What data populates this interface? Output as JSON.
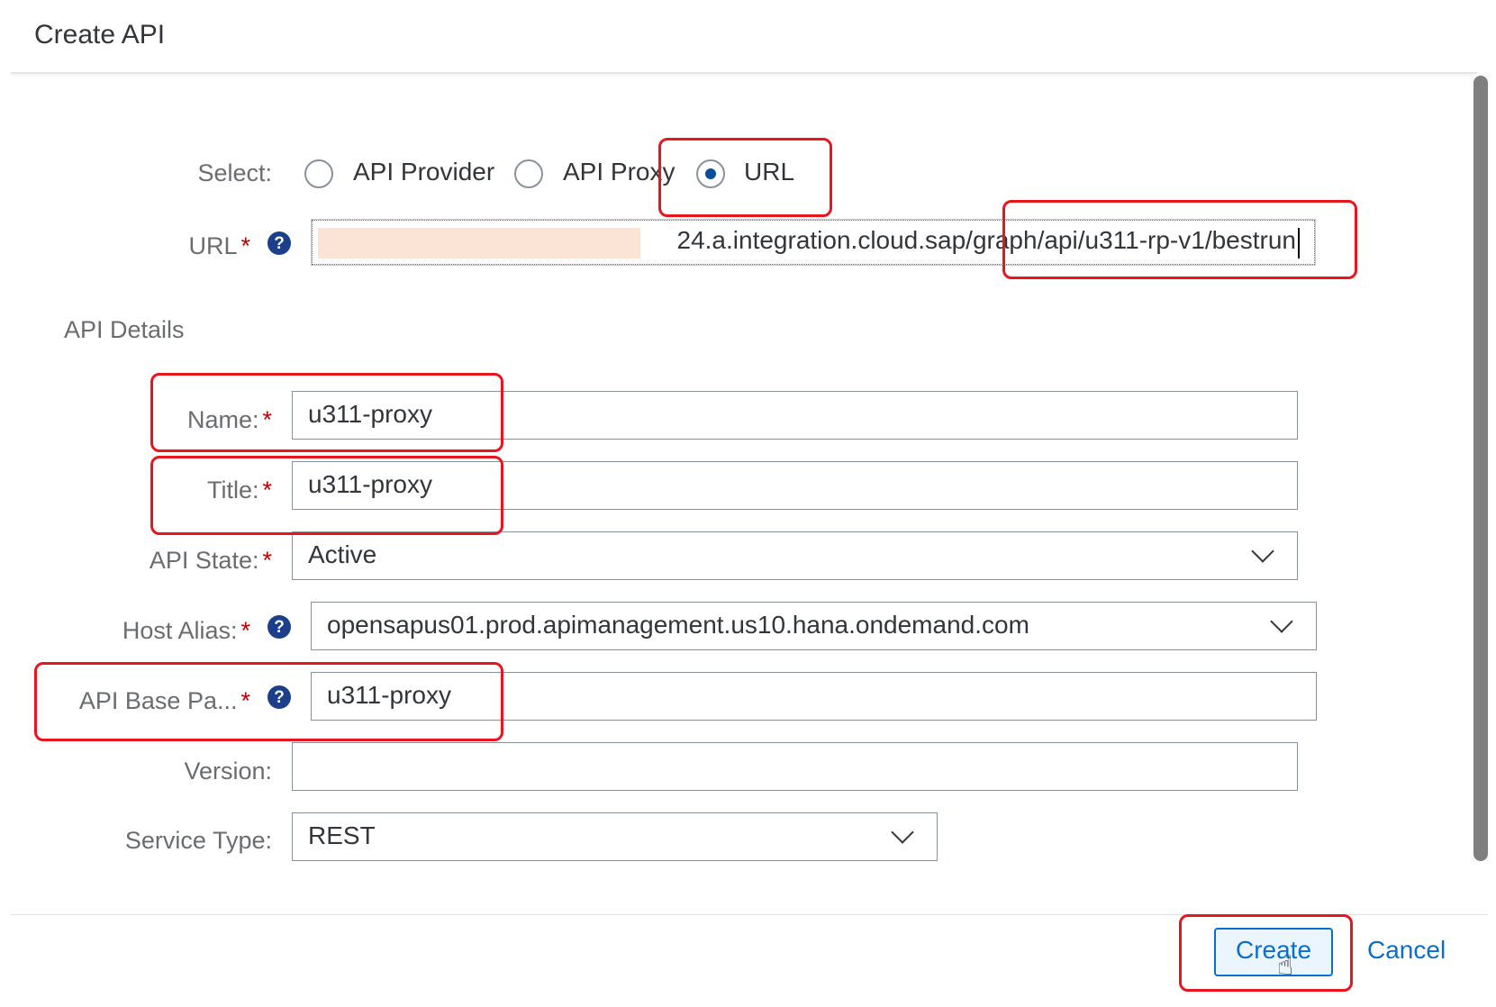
{
  "dialog": {
    "title": "Create API"
  },
  "select": {
    "label": "Select:",
    "options": [
      "API Provider",
      "API Proxy",
      "URL"
    ],
    "selected": "URL"
  },
  "url": {
    "label": "URL",
    "required_marker": "*",
    "value": "24.a.integration.cloud.sap/graph/api/u311-rp-v1/bestrun"
  },
  "details": {
    "section_title": "API Details",
    "name": {
      "label": "Name:",
      "value": "u311-proxy"
    },
    "title": {
      "label": "Title:",
      "value": "u311-proxy"
    },
    "state": {
      "label": "API State:",
      "value": "Active"
    },
    "host_alias": {
      "label": "Host Alias:",
      "value": "opensapus01.prod.apimanagement.us10.hana.ondemand.com"
    },
    "base_path": {
      "label": "API Base Pa...",
      "value": "u311-proxy"
    },
    "version": {
      "label": "Version:",
      "value": ""
    },
    "service_type": {
      "label": "Service Type:",
      "value": "REST"
    },
    "required_marker": "*"
  },
  "footer": {
    "create_label": "Create",
    "cancel_label": "Cancel"
  },
  "icons": {
    "help": "?",
    "cursor": "hand-pointer-icon"
  },
  "colors": {
    "accent": "#0a6ed1",
    "required": "#bb0000",
    "annotation": "#e8141e",
    "help_icon": "#1b3f8b"
  }
}
